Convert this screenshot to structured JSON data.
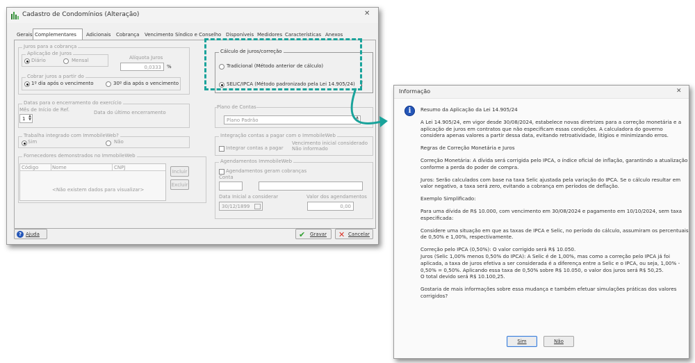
{
  "main_window": {
    "title": "Cadastro de Condomínios (Alteração)",
    "tabs": [
      "Gerais",
      "Complementares",
      "Adicionais",
      "Cobrança",
      "Vencimento",
      "Síndico e Conselho",
      "Disponíveis",
      "Medidores",
      "Características",
      "Anexos"
    ],
    "selected_tab": "Complementares",
    "juros": {
      "group_label": "Juros para a cobrança",
      "aplicacao_label": "Aplicação de Juros",
      "opt_diario": "Diário",
      "opt_mensal": "Mensal",
      "aliquota_label": "Alíquota Juros",
      "aliquota_value": "0,0333",
      "percent": "%",
      "cobrar_label": "Cobrar juros a partir do",
      "opt_primeiro": "1º dia após o vencimento",
      "opt_trigesimo": "30º dia após o vencimento"
    },
    "datas": {
      "group_label": "Datas para o encerramento do exercício",
      "mes_label": "Mês de Início de Ref.",
      "mes_value": "1",
      "ultimo_label": "Data do último encerramento"
    },
    "integrado": {
      "group_label": "Trabalha integrado com ImmobileWeb?",
      "opt_sim": "Sim",
      "opt_nao": "Não"
    },
    "fornecedores": {
      "group_label": "Fornecedores demonstrados no ImmobileWeb",
      "columns": [
        "Código",
        "Nome",
        "CNPJ"
      ],
      "empty_text": "<Não existem dados para visualizar>",
      "btn_incluir": "Incluir",
      "btn_excluir": "Excluir"
    },
    "calculo": {
      "group_label": "Cálculo de juros/correção",
      "opt_tradicional": "Tradicional (Método anterior de cálculo)",
      "opt_selic": "SELIC/IPCA (Método padronizado pela Lei 14.905/24)",
      "info_icon_glyph": "i"
    },
    "plano": {
      "label": "Plano de Contas",
      "value": "Plano Padrão"
    },
    "integracao": {
      "group_label": "Integração contas a pagar com o ImmobileWeb",
      "chk_label": "Integrar contas a pagar",
      "venc_label": "Vencimento inicial considerado",
      "venc_value": "Não informado"
    },
    "agendamentos": {
      "group_label": "Agendamentos ImmobileWeb",
      "chk_label": "Agendamentos geram cobranças",
      "conta_label": "Conta",
      "data_label": "Data Inicial a considerar",
      "data_value": "30/12/1899",
      "valor_label": "Valor dos agendamentos",
      "valor_value": "0,00"
    },
    "footer": {
      "ajuda": "Ajuda",
      "gravar": "Gravar",
      "cancelar": "Cancelar"
    }
  },
  "info_dialog": {
    "title": "Informação",
    "heading": "Resumo da Aplicação da Lei 14.905/24",
    "paragraphs": [
      "A Lei 14.905/24, em vigor desde 30/08/2024, estabelece novas diretrizes para a correção monetária e a aplicação de juros em contratos que não especificam essas condições. A calculadora do governo considera apenas valores a partir dessa data, evitando retroatividade, litígios e minimizando erros.",
      "Regras de Correção Monetária e Juros",
      "Correção Monetária: A dívida será corrigida pelo IPCA, o índice oficial de inflação, garantindo a atualização conforme a perda do poder de compra.",
      "Juros: Serão calculados com base na taxa Selic ajustada pela variação do IPCA. Se o cálculo resultar em valor negativo, a taxa será zero, evitando a cobrança em períodos de deflação.",
      "Exemplo Simplificado:",
      "Para uma dívida de R$ 10.000, com vencimento em 30/08/2024 e pagamento em 10/10/2024, sem taxa especificada:",
      "Considere uma situação em que as taxas de IPCA e Selic, no período do cálculo, assumiram os percentuais de 0,50% e 1,00%, respectivamente.",
      "Correção pelo IPCA (0,50%): O valor corrigido será R$ 10.050.\nJuros (Selic 1,00% menos 0,50% do IPCA): A Selic é de 1,00%, mas como a correção pelo IPCA já foi aplicada, a taxa de juros efetiva a ser considerada é a diferença entre a Selic e o IPCA, ou seja, 1,00% - 0,50% = 0,50%. Aplicando essa taxa de 0,50% sobre R$ 10.050, o valor dos juros será R$ 50,25.\nO total devido será R$ 10.100,25.",
      "Gostaria de mais informações sobre essa mudança e também efetuar simulações práticas dos valores corrigidos?"
    ],
    "btn_sim": "Sim",
    "btn_nao": "Não"
  },
  "colors": {
    "highlight": "#1aa39b",
    "info_icon": "#2456b8"
  }
}
